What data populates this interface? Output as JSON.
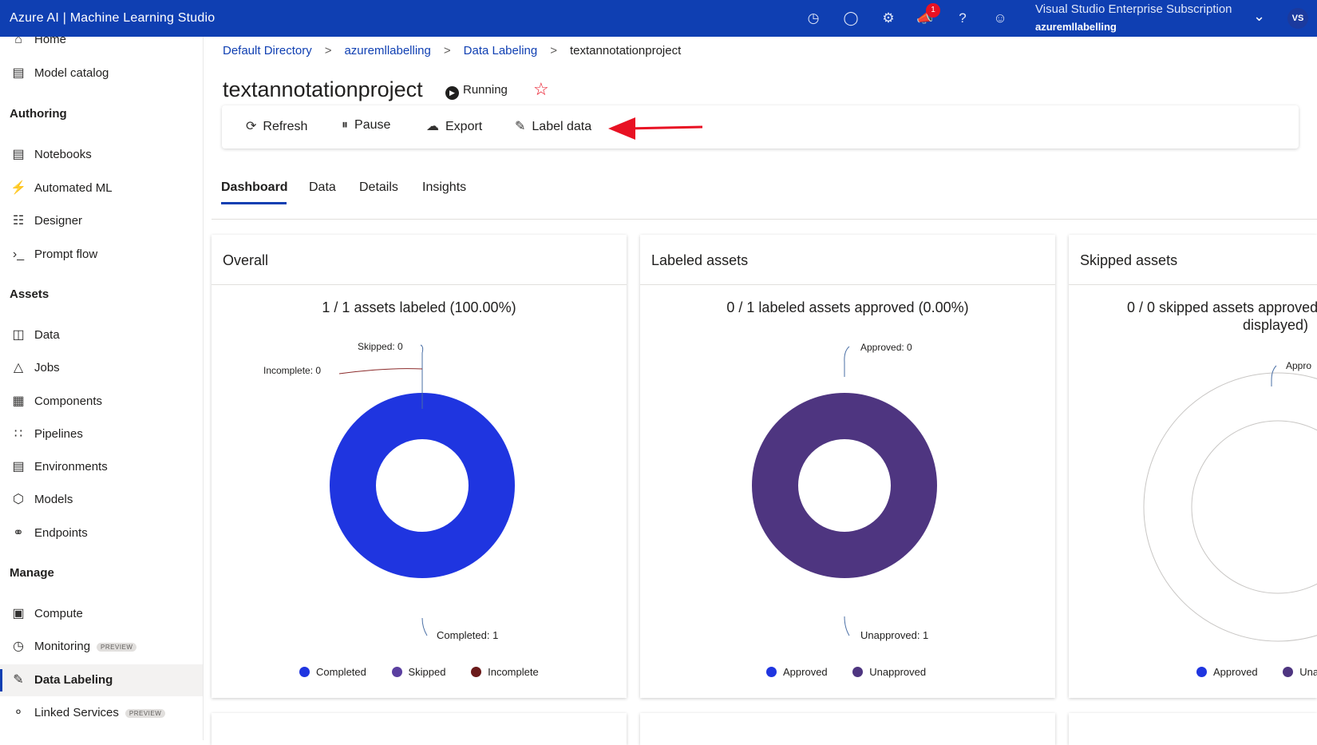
{
  "header": {
    "app_title": "Azure AI | Machine Learning Studio",
    "subscription": "Visual Studio Enterprise Subscription",
    "directory": "azuremllabelling",
    "avatar_initials": "VS",
    "notification_count": "1",
    "icons": [
      "clock-icon",
      "lightbulb-icon",
      "gear-icon",
      "megaphone-icon",
      "help-icon",
      "feedback-icon"
    ]
  },
  "sidebar": {
    "items_top": [
      {
        "label": "Home",
        "icon": "home-icon"
      },
      {
        "label": "Model catalog",
        "icon": "catalog-icon"
      }
    ],
    "authoring_label": "Authoring",
    "authoring_items": [
      {
        "label": "Notebooks",
        "icon": "notebook-icon"
      },
      {
        "label": "Automated ML",
        "icon": "automl-icon"
      },
      {
        "label": "Designer",
        "icon": "designer-icon"
      },
      {
        "label": "Prompt flow",
        "icon": "prompt-flow-icon"
      }
    ],
    "assets_label": "Assets",
    "assets_items": [
      {
        "label": "Data",
        "icon": "data-icon"
      },
      {
        "label": "Jobs",
        "icon": "jobs-icon"
      },
      {
        "label": "Components",
        "icon": "components-icon"
      },
      {
        "label": "Pipelines",
        "icon": "pipelines-icon"
      },
      {
        "label": "Environments",
        "icon": "environments-icon"
      },
      {
        "label": "Models",
        "icon": "models-icon"
      },
      {
        "label": "Endpoints",
        "icon": "endpoints-icon"
      }
    ],
    "manage_label": "Manage",
    "manage_items": [
      {
        "label": "Compute",
        "icon": "compute-icon"
      },
      {
        "label": "Monitoring",
        "icon": "monitoring-icon",
        "badge": "PREVIEW"
      },
      {
        "label": "Data Labeling",
        "icon": "data-labeling-icon",
        "active": true
      },
      {
        "label": "Linked Services",
        "icon": "linked-services-icon",
        "badge": "PREVIEW"
      }
    ]
  },
  "breadcrumb": [
    "Default Directory",
    "azuremllabelling",
    "Data Labeling",
    "textannotationproject"
  ],
  "page": {
    "title": "textannotationproject",
    "status": "Running"
  },
  "toolbar": {
    "refresh": "Refresh",
    "pause": "Pause",
    "export": "Export",
    "label_data": "Label data"
  },
  "tabs": [
    "Dashboard",
    "Data",
    "Details",
    "Insights"
  ],
  "active_tab": "Dashboard",
  "colors": {
    "brand": "#0f3fb2",
    "completed": "#1f35e0",
    "skipped": "#5b3fa0",
    "incomplete": "#6b1a1a",
    "approved": "#1f35e0",
    "unapproved": "#4e3580",
    "annotation_arrow": "#e81123"
  },
  "cards": {
    "overall": {
      "title": "Overall",
      "stat": "1 / 1 assets labeled (100.00%)",
      "labels": {
        "skipped": "Skipped: 0",
        "incomplete": "Incomplete: 0",
        "completed": "Completed: 1"
      },
      "legend": [
        "Completed",
        "Skipped",
        "Incomplete"
      ]
    },
    "labeled": {
      "title": "Labeled assets",
      "stat": "0 / 1 labeled assets approved (0.00%)",
      "labels": {
        "approved": "Approved: 0",
        "unapproved": "Unapproved: 1"
      },
      "legend": [
        "Approved",
        "Unapproved"
      ]
    },
    "skipped": {
      "title": "Skipped assets",
      "stat_line1": "0 / 0 skipped assets approved",
      "stat_line2": "displayed)",
      "label_top": "Appro",
      "legend": [
        "Approved",
        "Una"
      ]
    }
  },
  "chart_data": [
    {
      "type": "pie",
      "title": "Overall",
      "categories": [
        "Completed",
        "Skipped",
        "Incomplete"
      ],
      "values": [
        1,
        0,
        0
      ]
    },
    {
      "type": "pie",
      "title": "Labeled assets",
      "categories": [
        "Approved",
        "Unapproved"
      ],
      "values": [
        0,
        1
      ]
    },
    {
      "type": "pie",
      "title": "Skipped assets",
      "categories": [
        "Approved",
        "Unapproved"
      ],
      "values": [
        0,
        0
      ]
    }
  ]
}
